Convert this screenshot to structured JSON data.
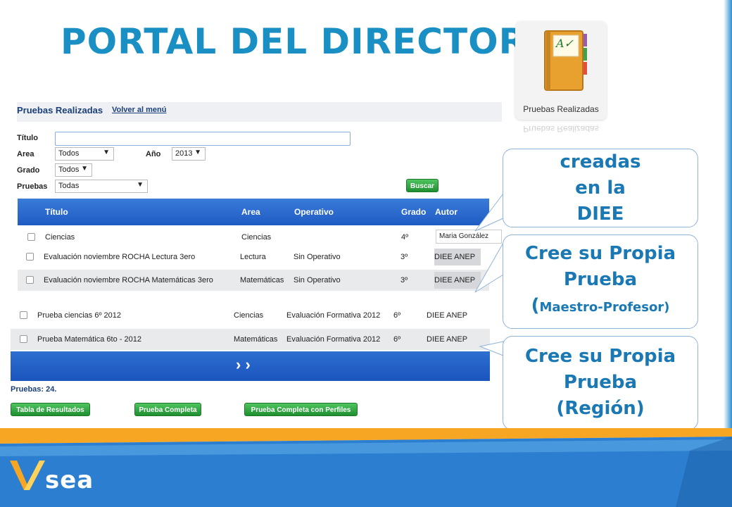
{
  "slide": {
    "title": "PORTAL DEL DIRECTOR"
  },
  "icon_tile": {
    "label": "Pruebas Realizadas",
    "reflection": "Pruebas Realizadas",
    "check_mark": "A✓"
  },
  "panel": {
    "heading": "Pruebas Realizadas",
    "back_link": "Volver al menú",
    "filters": {
      "titulo_label": "Título",
      "titulo_value": "",
      "area_label": "Area",
      "area_value": "Todos",
      "anio_label": "Año",
      "anio_value": "2013",
      "grado_label": "Grado",
      "grado_value": "Todos",
      "pruebas_label": "Pruebas",
      "pruebas_value": "Todas",
      "buscar_label": "Buscar"
    },
    "table": {
      "headers": {
        "titulo": "Título",
        "area": "Area",
        "operativo": "Operativo",
        "grado": "Grado",
        "autor": "Autor"
      },
      "rows": [
        {
          "titulo": "Ciencias",
          "area": "Ciencias",
          "operativo": "",
          "grado": "4º",
          "autor": "Maria González"
        },
        {
          "titulo": "Evaluación noviembre ROCHA Lectura 3ero",
          "area": "Lectura",
          "operativo": "Sin Operativo",
          "grado": "3º",
          "autor": "DIEE ANEP"
        },
        {
          "titulo": "Evaluación noviembre ROCHA Matemáticas 3ero",
          "area": "Matemáticas",
          "operativo": "Sin Operativo",
          "grado": "3º",
          "autor": "DIEE ANEP"
        },
        {
          "titulo": "Prueba ciencias 6º 2012",
          "area": "Ciencias",
          "operativo": "Evaluación Formativa 2012",
          "grado": "6º",
          "autor": "DIEE ANEP"
        },
        {
          "titulo": "Prueba Matemática 6to - 2012",
          "area": "Matemáticas",
          "operativo": "Evaluación Formativa 2012",
          "grado": "6º",
          "autor": "DIEE ANEP"
        }
      ],
      "pager": "› ›",
      "count": "Pruebas: 24."
    },
    "buttons": {
      "tabla": "Tabla de Resultados",
      "completa": "Prueba Completa",
      "perfiles": "Prueba Completa con Perfiles"
    }
  },
  "callouts": {
    "diee": {
      "line1": "creadas",
      "line2": "en la",
      "line3": "DIEE"
    },
    "maestro": {
      "line1": "Cree su Propia",
      "line2": "Prueba",
      "paren_open": "(",
      "line3": "Maestro-Profesor)"
    },
    "region": {
      "line1": "Cree su Propia",
      "line2": "Prueba",
      "line3": "(Región)"
    }
  },
  "footer": {
    "logo_text": "sea"
  },
  "colors": {
    "title": "#1a8fc4",
    "table_header": "#2a6ad0",
    "band_orange": "#f6a623",
    "band_blue": "#2c7fd0"
  }
}
